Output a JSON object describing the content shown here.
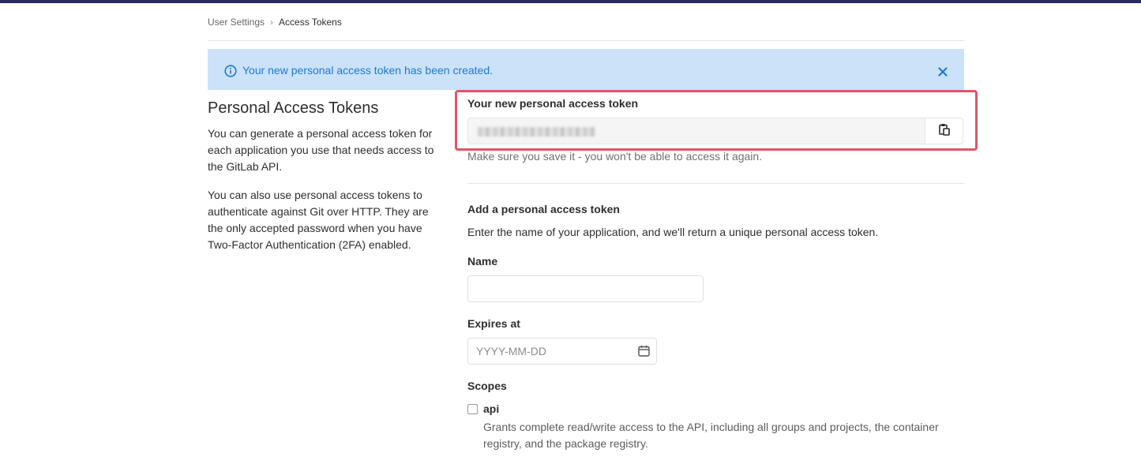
{
  "breadcrumb": {
    "parent": "User Settings",
    "separator": "›",
    "current": "Access Tokens"
  },
  "flash": {
    "message": "Your new personal access token has been created.",
    "icons": {
      "info": "info-circle-icon",
      "close": "close-icon"
    },
    "color": "#1f78d1",
    "background": "#cbe2f9"
  },
  "sidebar": {
    "title": "Personal Access Tokens",
    "paragraph1": "You can generate a personal access token for each application you use that needs access to the GitLab API.",
    "paragraph2": "You can also use personal access tokens to authenticate against Git over HTTP. They are the only accepted password when you have Two-Factor Authentication (2FA) enabled."
  },
  "new_token": {
    "label": "Your new personal access token",
    "value_obscured": true,
    "help": "Make sure you save it - you won't be able to access it again.",
    "copy_icon": "clipboard-icon",
    "highlight_color": "#e0556a"
  },
  "form": {
    "title": "Add a personal access token",
    "description": "Enter the name of your application, and we'll return a unique personal access token.",
    "name_label": "Name",
    "name_value": "",
    "expires_label": "Expires at",
    "expires_placeholder": "YYYY-MM-DD",
    "calendar_icon": "calendar-icon",
    "scopes_label": "Scopes",
    "scopes": [
      {
        "name": "api",
        "checked": false,
        "description": "Grants complete read/write access to the API, including all groups and projects, the container registry, and the package registry."
      }
    ]
  },
  "colors": {
    "topbar": "#292961",
    "text": "#2e2e2e",
    "muted": "#707070"
  }
}
